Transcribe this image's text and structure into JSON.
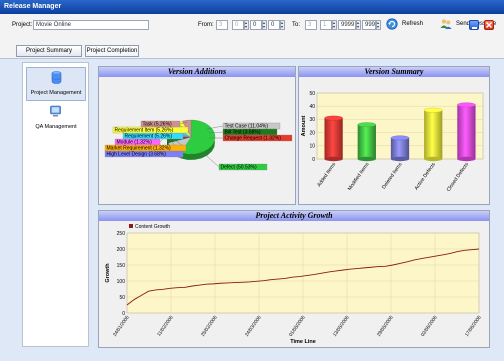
{
  "window": {
    "title": "Release Manager"
  },
  "header": {
    "project_label": "Project:",
    "project_value": "Movie Online",
    "from_label": "From:",
    "from_fields": [
      "3",
      "0",
      "0",
      "0"
    ],
    "to_label": "To:",
    "to_fields": [
      "3",
      "1",
      "9999",
      "999"
    ],
    "refresh_label": "Refresh",
    "send_message_label": "Send Message"
  },
  "tabs": [
    {
      "label": "Project Summary"
    },
    {
      "label": "Project Completion"
    }
  ],
  "sidebar": {
    "items": [
      {
        "label": "Project Management",
        "icon": "database-icon"
      },
      {
        "label": "QA Management",
        "icon": "monitor-icon"
      }
    ]
  },
  "colors": {
    "panel_title": "#8b93f0",
    "plot_bg": "#fdf6c8",
    "line": "#8b1a1a"
  },
  "chart_data": [
    {
      "type": "pie",
      "title": "Version Additions",
      "slices": [
        {
          "label": "Defect (50.53%)",
          "value": 50.53,
          "color": "#2ecc40"
        },
        {
          "label": "Test Case (11.04%)",
          "value": 11.04,
          "color": "#c8c8c8"
        },
        {
          "label": "Bill Test (3.68%)",
          "value": 3.68,
          "color": "#1b7a1b"
        },
        {
          "label": "Change Request (1.32%)",
          "value": 1.32,
          "color": "#e63a2a"
        },
        {
          "label": "High Level Design (3.68%)",
          "value": 3.68,
          "color": "#7d7dff"
        },
        {
          "label": "Market Requirement (1.32%)",
          "value": 1.32,
          "color": "#ffb000"
        },
        {
          "label": "Module (1.32%)",
          "value": 1.32,
          "color": "#ff66ff"
        },
        {
          "label": "Requirement (5.26%)",
          "value": 5.26,
          "color": "#33ddff"
        },
        {
          "label": "Requirement Item (5.26%)",
          "value": 5.26,
          "color": "#ffff33"
        },
        {
          "label": "Task (5.26%)",
          "value": 5.26,
          "color": "#d09090"
        }
      ]
    },
    {
      "type": "bar",
      "title": "Version Summary",
      "ylabel": "Amount",
      "ylim": [
        0,
        50
      ],
      "yticks": [
        "0",
        "10",
        "20",
        "30",
        "40",
        "50"
      ],
      "categories": [
        "Added Items",
        "Modified Items",
        "Deleted Items",
        "Active Defects",
        "Closed Defects"
      ],
      "values": [
        31,
        26,
        16,
        37,
        41
      ],
      "colors": [
        "#e53935",
        "#43c143",
        "#7b7bdc",
        "#f2f23a",
        "#e94ae9"
      ]
    },
    {
      "type": "line",
      "title": "Project Activity Growth",
      "xlabel": "Time Line",
      "ylabel": "Growth",
      "ylim": [
        0,
        250
      ],
      "yticks": [
        "0",
        "50",
        "100",
        "150",
        "200",
        "250"
      ],
      "xticks": [
        "24/01/2006",
        "11/02/2006",
        "25/02/2006",
        "24/03/2006",
        "01/05/2006",
        "13/05/2006",
        "29/05/2006",
        "02/06/2006",
        "17/06/2006"
      ],
      "series": [
        {
          "name": "Content Growth",
          "values": [
            25,
            42,
            55,
            68,
            72,
            74,
            77,
            79,
            80,
            84,
            87,
            90,
            91,
            93,
            94,
            95,
            96,
            97,
            99,
            101,
            104,
            106,
            108,
            112,
            114,
            117,
            120,
            124,
            128,
            131,
            134,
            137,
            139,
            141,
            143,
            145,
            146,
            150,
            155,
            160,
            166,
            170,
            174,
            178,
            182,
            186,
            192,
            196,
            198,
            200
          ]
        }
      ]
    }
  ]
}
